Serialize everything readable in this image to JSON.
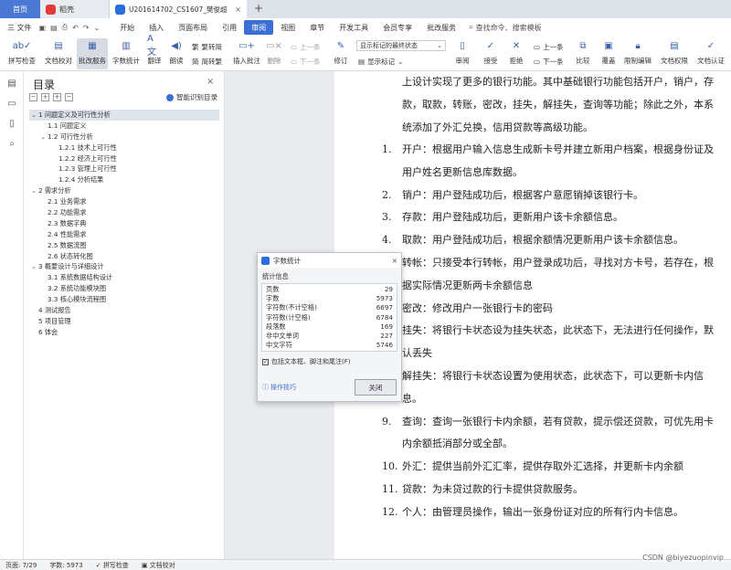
{
  "titlebar": {
    "home_tab": "首页",
    "wps_tab": "稻壳",
    "doc_tab": "U201614702_CS1607_樊俊超",
    "new_tab": "+"
  },
  "menu": {
    "file_label": "三 文件",
    "tabs": [
      "开始",
      "插入",
      "页面布局",
      "引用",
      "审阅",
      "视图",
      "章节",
      "开发工具",
      "会员专享",
      "批改服务"
    ],
    "active_tab": "审阅",
    "search_label": "查找命令、搜索模板"
  },
  "ribbon": {
    "spell_check": "拼写检查",
    "doc_proof": "文档校对",
    "batch_service": "批改服务",
    "word_count": "字数统计",
    "translate": "翻译",
    "read_aloud": "朗读",
    "trad_to_simp": "繁转简",
    "simp_to_trad": "简转繁",
    "insert_comment": "插入批注",
    "delete": "删除",
    "prev_one": "上一条",
    "next_one": "下一条",
    "track_changes": "修订",
    "markup_select": "显示标记的最终状态",
    "show_markup": "显示标记",
    "review": "审阅",
    "accept": "接受",
    "reject": "拒绝",
    "prev_change": "上一条",
    "next_change": "下一条",
    "compare": "比较",
    "restrict": "限制编辑",
    "protect": "文档权限",
    "doc_cert": "文档认证",
    "cover": "覆盖"
  },
  "toc": {
    "title": "目录",
    "smart_toc": "智能识别目录",
    "items": [
      {
        "level": 1,
        "text": "1 问题定义及可行性分析",
        "arrow": "⌄",
        "selected": true
      },
      {
        "level": 2,
        "text": "1.1 问题定义",
        "arrow": ""
      },
      {
        "level": 2,
        "text": "1.2 可行性分析",
        "arrow": "⌄"
      },
      {
        "level": 3,
        "text": "1.2.1 技术上可行性",
        "arrow": ""
      },
      {
        "level": 3,
        "text": "1.2.2 经济上可行性",
        "arrow": ""
      },
      {
        "level": 3,
        "text": "1.2.3 管理上可行性",
        "arrow": ""
      },
      {
        "level": 3,
        "text": "1.2.4 分析结果",
        "arrow": ""
      },
      {
        "level": 1,
        "text": "2 需求分析",
        "arrow": "⌄"
      },
      {
        "level": 2,
        "text": "2.1 业务需求",
        "arrow": ""
      },
      {
        "level": 2,
        "text": "2.2 功能需求",
        "arrow": ""
      },
      {
        "level": 2,
        "text": "2.3 数据字典",
        "arrow": ""
      },
      {
        "level": 2,
        "text": "2.4 性能需求",
        "arrow": ""
      },
      {
        "level": 2,
        "text": "2.5 数据流图",
        "arrow": ""
      },
      {
        "level": 2,
        "text": "2.6 状态转化图",
        "arrow": ""
      },
      {
        "level": 1,
        "text": "3 概要设计与详细设计",
        "arrow": "⌄"
      },
      {
        "level": 2,
        "text": "3.1 系统数据结构设计",
        "arrow": ""
      },
      {
        "level": 2,
        "text": "3.2 系统功能模块图",
        "arrow": ""
      },
      {
        "level": 2,
        "text": "3.3 核心模块流程图",
        "arrow": ""
      },
      {
        "level": 1,
        "text": "4 测试报告",
        "arrow": ""
      },
      {
        "level": 1,
        "text": "5 项目管理",
        "arrow": ""
      },
      {
        "level": 1,
        "text": "6 体会",
        "arrow": ""
      }
    ]
  },
  "document": {
    "intro": "上设计实现了更多的银行功能。其中基础银行功能包括开户，销户，存款，取款，转账，密改，挂失，解挂失，查询等功能；除此之外，本系统添加了外汇兑换，信用贷款等高级功能。",
    "list": [
      {
        "num": "1.",
        "text": "开户：根据用户输入信息生成新卡号并建立新用户档案，根据身份证及用户姓名更新信息库数据。"
      },
      {
        "num": "2.",
        "text": "销户：用户登陆成功后，根据客户意愿销掉该银行卡。"
      },
      {
        "num": "3.",
        "text": "存款：用户登陆成功后，更新用户该卡余额信息。"
      },
      {
        "num": "4.",
        "text": "取款：用户登陆成功后，根据余额情况更新用户该卡余额信息。"
      },
      {
        "num": "5.",
        "text": "转帐：只接受本行转帐，用户登录成功后，寻找对方卡号，若存在，根据实际情况更新两卡余额信息"
      },
      {
        "num": "6.",
        "text": "密改：修改用户一张银行卡的密码"
      },
      {
        "num": "7.",
        "text": "挂失：将银行卡状态设为挂失状态，此状态下，无法进行任何操作，默认丢失"
      },
      {
        "num": "8.",
        "text": "解挂失：将银行卡状态设置为使用状态，此状态下，可以更新卡内信息。"
      },
      {
        "num": "9.",
        "text": "查询：查询一张银行卡内余额，若有贷款，提示偿还贷款，可优先用卡内余额抵消部分或全部。"
      },
      {
        "num": "10.",
        "text": "外汇：提供当前外汇汇率，提供存取外汇选择，并更新卡内余额"
      },
      {
        "num": "11.",
        "text": "贷款：为未贷过款的行卡提供贷款服务。"
      },
      {
        "num": "12.",
        "text": "个人：由管理员操作，输出一张身份证对应的所有行内卡信息。"
      }
    ]
  },
  "dialog": {
    "title": "字数统计",
    "section": "统计信息",
    "rows": [
      {
        "label": "页数",
        "value": "29"
      },
      {
        "label": "字数",
        "value": "5973"
      },
      {
        "label": "字符数(不计空格)",
        "value": "6697"
      },
      {
        "label": "字符数(计空格)",
        "value": "6784"
      },
      {
        "label": "段落数",
        "value": "169"
      },
      {
        "label": "非中文单词",
        "value": "227"
      },
      {
        "label": "中文字符",
        "value": "5746"
      }
    ],
    "checkbox_label": "包括文本框、脚注和尾注(F)",
    "tips": "操作技巧",
    "close": "关闭"
  },
  "status": {
    "page": "页面: 7/29",
    "words": "字数: 5973",
    "spell": "拼写检查",
    "proof": "文档校对"
  },
  "watermark": "CSDN @biyezuopinvip"
}
